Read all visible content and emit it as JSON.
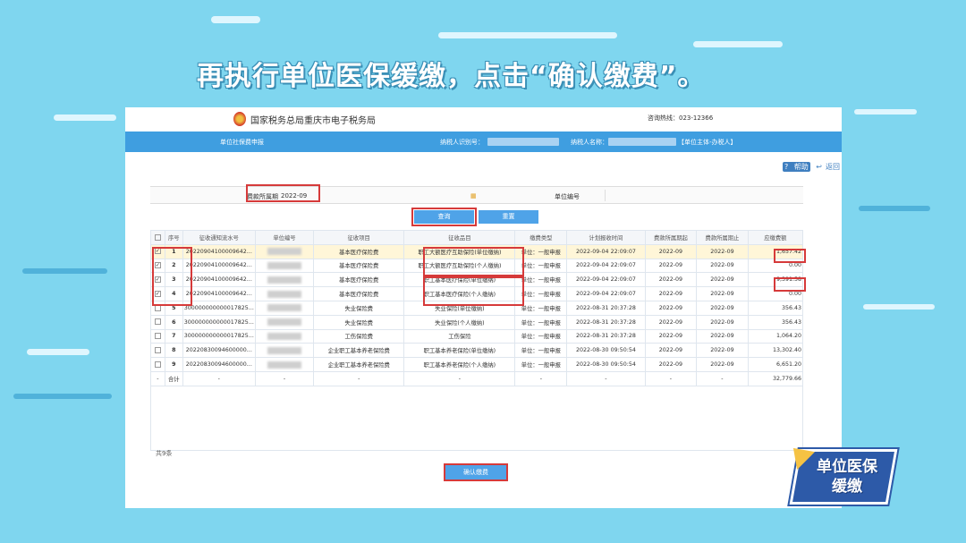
{
  "headline": "再执行单位医保缓缴，点击“确认缴费”。",
  "site": {
    "name": "国家税务总局重庆市电子税务局",
    "hotline": "咨询热线：023-12366"
  },
  "bluebar": {
    "module": "单位社保费申报",
    "taxpayer_id_label": "纳税人识别号：",
    "taxpayer_name_label": "纳税人名称：",
    "role": "【单位主体-办税人】"
  },
  "toolbar": {
    "help": "帮助",
    "back": "返回"
  },
  "form": {
    "period_label": "费款所属期",
    "period_value": "2022-09",
    "unit_no_label": "单位编号"
  },
  "buttons": {
    "query": "查询",
    "reset": "重置",
    "confirm": "确认缴费"
  },
  "table": {
    "headers": [
      "序号",
      "征收通知流水号",
      "单位编号",
      "征收项目",
      "征收品目",
      "缴费类型",
      "计划报收时间",
      "费款所属期起",
      "费款所属期止",
      "应缴费额"
    ],
    "rows": [
      {
        "seq": "1",
        "serial": "20220904100009642...",
        "item": "基本医疗保险费",
        "subitem": "职工大额医疗互助保险(单位缴纳)",
        "type": "单位：一般申报",
        "time": "2022-09-04 22:09:07",
        "from": "2022-09",
        "to": "2022-09",
        "amount": "1,657.42",
        "checked": "✓"
      },
      {
        "seq": "2",
        "serial": "20220904100009642...",
        "item": "基本医疗保险费",
        "subitem": "职工大额医疗互助保险(个人缴纳)",
        "type": "单位：一般申报",
        "time": "2022-09-04 22:09:07",
        "from": "2022-09",
        "to": "2022-09",
        "amount": "0.00",
        "checked": "✓"
      },
      {
        "seq": "3",
        "serial": "20220904100009642...",
        "item": "基本医疗保险费",
        "subitem": "职工基本医疗保险(单位缴纳)",
        "type": "单位：一般申报",
        "time": "2022-09-04 22:09:07",
        "from": "2022-09",
        "to": "2022-09",
        "amount": "9,391.58",
        "checked": "✓"
      },
      {
        "seq": "4",
        "serial": "20220904100009642...",
        "item": "基本医疗保险费",
        "subitem": "职工基本医疗保险(个人缴纳)",
        "type": "单位：一般申报",
        "time": "2022-09-04 22:09:07",
        "from": "2022-09",
        "to": "2022-09",
        "amount": "0.00",
        "checked": "✓"
      },
      {
        "seq": "5",
        "serial": "300000000000017825...",
        "item": "失业保险费",
        "subitem": "失业保险(单位缴纳)",
        "type": "单位：一般申报",
        "time": "2022-08-31 20:37:28",
        "from": "2022-09",
        "to": "2022-09",
        "amount": "356.43",
        "checked": ""
      },
      {
        "seq": "6",
        "serial": "300000000000017825...",
        "item": "失业保险费",
        "subitem": "失业保险(个人缴纳)",
        "type": "单位：一般申报",
        "time": "2022-08-31 20:37:28",
        "from": "2022-09",
        "to": "2022-09",
        "amount": "356.43",
        "checked": ""
      },
      {
        "seq": "7",
        "serial": "300000000000017825...",
        "item": "工伤保险费",
        "subitem": "工伤保险",
        "type": "单位：一般申报",
        "time": "2022-08-31 20:37:28",
        "from": "2022-09",
        "to": "2022-09",
        "amount": "1,064.20",
        "checked": ""
      },
      {
        "seq": "8",
        "serial": "20220830094600000...",
        "item": "企业职工基本养老保险费",
        "subitem": "职工基本养老保险(单位缴纳)",
        "type": "单位：一般申报",
        "time": "2022-08-30 09:50:54",
        "from": "2022-09",
        "to": "2022-09",
        "amount": "13,302.40",
        "checked": ""
      },
      {
        "seq": "9",
        "serial": "20220830094600000...",
        "item": "企业职工基本养老保险费",
        "subitem": "职工基本养老保险(个人缴纳)",
        "type": "单位：一般申报",
        "time": "2022-08-30 09:50:54",
        "from": "2022-09",
        "to": "2022-09",
        "amount": "6,651.20",
        "checked": ""
      }
    ],
    "total_row": {
      "label": "合计",
      "dash": "-",
      "amount": "32,779.66"
    },
    "count": "共9条"
  },
  "badge": {
    "line1": "单位医保",
    "line2": "缓缴"
  },
  "colors": {
    "background": "#7fd6ef",
    "bar": "#3f9ee0",
    "highlight": "#d63a3a",
    "badge": "#2d5aa8"
  }
}
